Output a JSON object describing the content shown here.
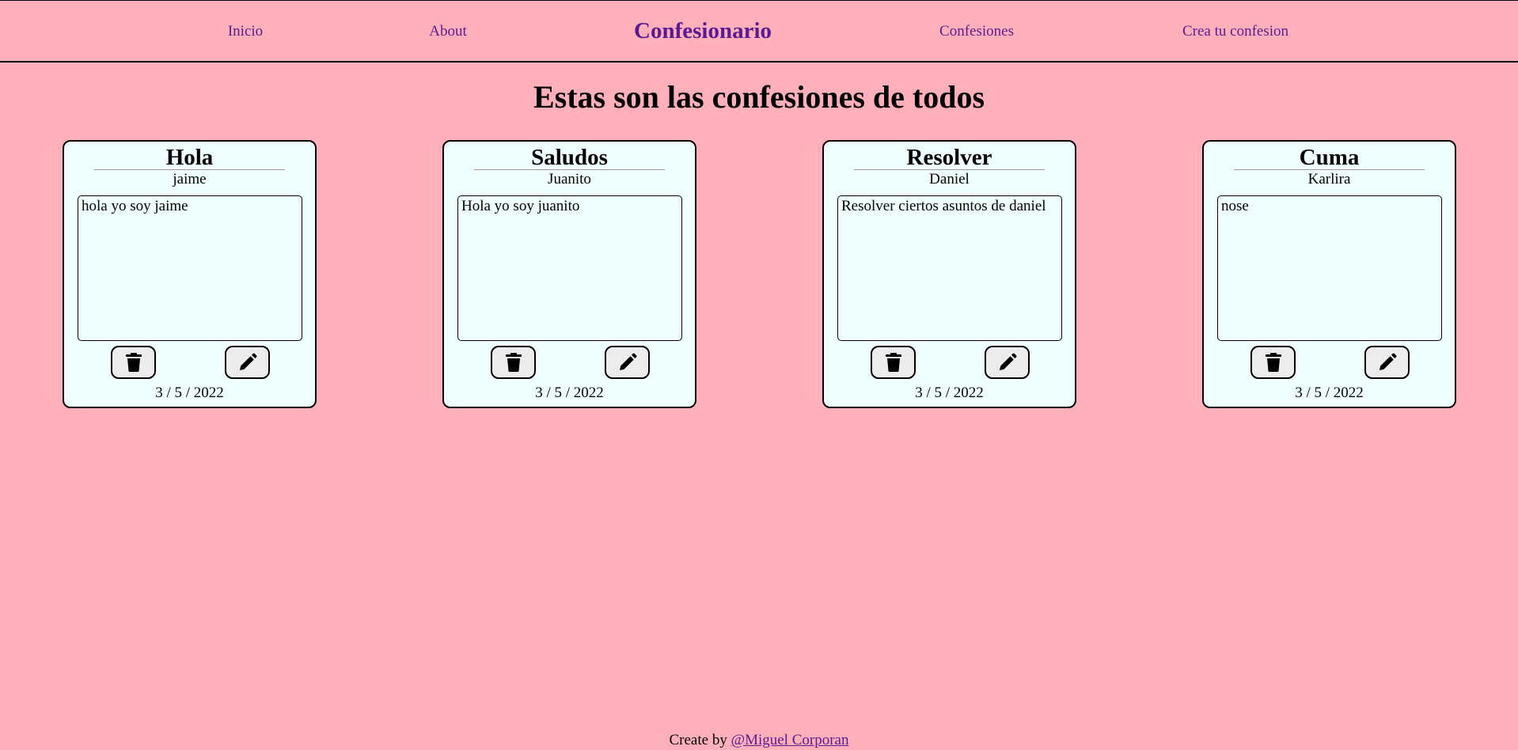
{
  "nav": {
    "links": [
      {
        "label": "Inicio"
      },
      {
        "label": "About"
      },
      {
        "label": "Confesiones"
      },
      {
        "label": "Crea tu confesion"
      }
    ],
    "brand": "Confesionario"
  },
  "page_title": "Estas son las confesiones de todos",
  "cards": [
    {
      "title": "Hola",
      "author": "jaime",
      "body": "hola yo soy jaime",
      "date": "3 / 5 / 2022"
    },
    {
      "title": "Saludos",
      "author": "Juanito",
      "body": "Hola yo soy juanito",
      "date": "3 / 5 / 2022"
    },
    {
      "title": "Resolver",
      "author": "Daniel",
      "body": "Resolver ciertos asuntos de daniel",
      "date": "3 / 5 / 2022"
    },
    {
      "title": "Cuma",
      "author": "Karlira",
      "body": "nose",
      "date": "3 / 5 / 2022"
    }
  ],
  "card_actions": {
    "delete_icon": "trash-icon",
    "edit_icon": "pencil-icon"
  },
  "footer": {
    "prefix": "Create by ",
    "link": "@Miguel Corporan"
  },
  "colors": {
    "background": "#ffb0ba",
    "nav_text": "#5a1a91",
    "card_background": "#eefffe",
    "button_background": "#ececec"
  }
}
